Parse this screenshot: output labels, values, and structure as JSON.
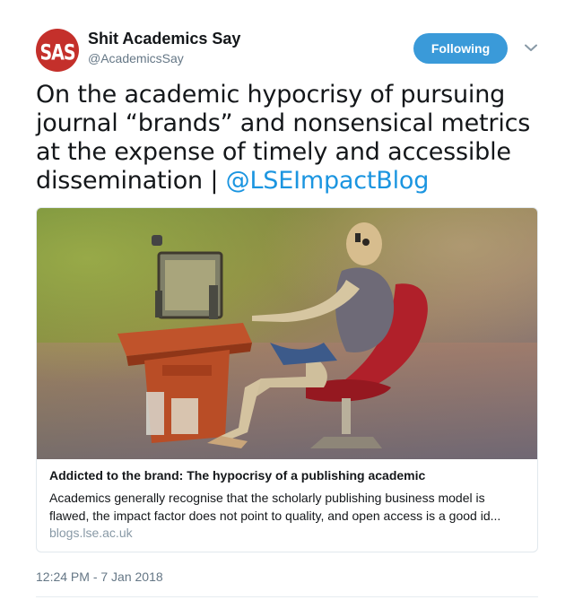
{
  "author": {
    "avatar_text": "SAS",
    "name": "Shit Academics Say",
    "handle": "@AcademicsSay"
  },
  "actions": {
    "follow_label": "Following",
    "caret_icon": "chevron-down-icon"
  },
  "tweet": {
    "text": "On the academic hypocrisy of pursuing journal “brands” and nonsensical metrics at the expense of timely and accessible dissemination | ",
    "mention": "@LSEImpactBlog"
  },
  "card": {
    "image_alt": "skeleton figurine sitting at a computer desk",
    "title": "Addicted to the brand: The hypocrisy of a publishing academic",
    "description": "Academics generally recognise that the scholarly publishing business model is flawed, the impact factor does not point to quality, and open access is a good id...",
    "domain": "blogs.lse.ac.uk"
  },
  "meta": {
    "timestamp": "12:24 PM - 7 Jan 2018"
  },
  "colors": {
    "accent": "#1b95e0",
    "follow_button": "#3a9ad9",
    "avatar_bg": "#c4302b",
    "secondary_text": "#657786"
  }
}
